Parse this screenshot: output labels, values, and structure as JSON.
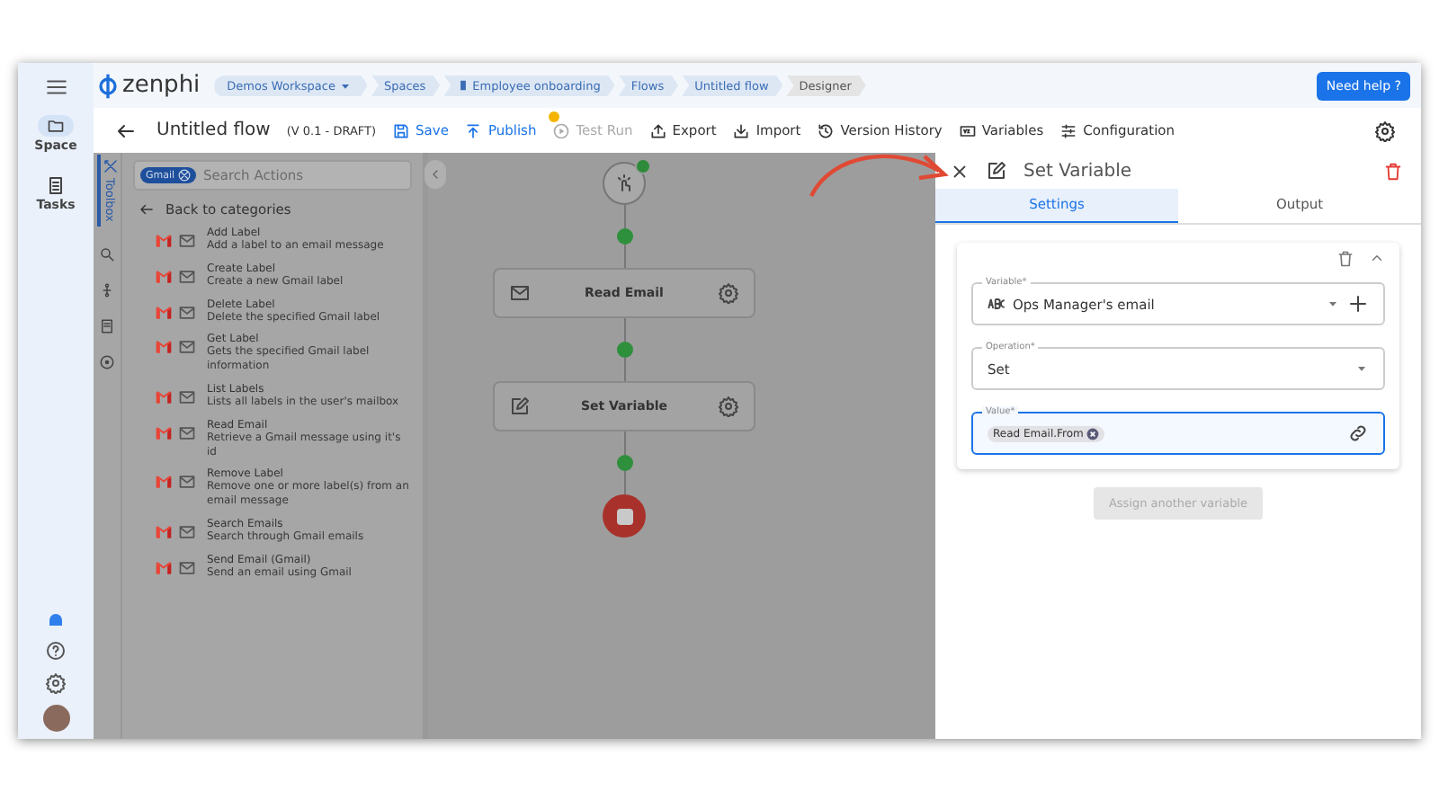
{
  "sidebar": {
    "items": [
      {
        "label": "Space",
        "selected": true
      },
      {
        "label": "Tasks",
        "selected": false
      }
    ]
  },
  "header": {
    "logo": "zenphi",
    "breadcrumbs": [
      "Demos Workspace",
      "Spaces",
      "Employee onboarding",
      "Flows",
      "Untitled flow",
      "Designer"
    ],
    "help_button": "Need help ?"
  },
  "toolbar": {
    "title": "Untitled flow",
    "version": "(V 0.1 - DRAFT)",
    "actions": [
      {
        "label": "Save",
        "kind": "primary"
      },
      {
        "label": "Publish",
        "kind": "primary"
      },
      {
        "label": "Test Run",
        "kind": "disabled"
      },
      {
        "label": "Export",
        "kind": "default"
      },
      {
        "label": "Import",
        "kind": "default"
      },
      {
        "label": "Version History",
        "kind": "default"
      },
      {
        "label": "Variables",
        "kind": "default"
      },
      {
        "label": "Configuration",
        "kind": "default"
      }
    ]
  },
  "toolbox": {
    "tab": "Toolbox",
    "filter_chip": "Gmail",
    "search": {
      "placeholder": "Search Actions"
    },
    "back": "Back to categories",
    "actions": [
      {
        "title": "Add Label",
        "description": "Add a label to an email message"
      },
      {
        "title": "Create Label",
        "description": "Create a new Gmail label"
      },
      {
        "title": "Delete Label",
        "description": "Delete the specified Gmail label"
      },
      {
        "title": "Get Label",
        "description": "Gets the specified Gmail label information"
      },
      {
        "title": "List Labels",
        "description": "Lists all labels in the user's mailbox"
      },
      {
        "title": "Read Email",
        "description": "Retrieve a Gmail message using it's id"
      },
      {
        "title": "Remove Label",
        "description": "Remove one or more label(s) from an email message"
      },
      {
        "title": "Search Emails",
        "description": "Search through Gmail emails"
      },
      {
        "title": "Send Email (Gmail)",
        "description": "Send an email using Gmail"
      }
    ]
  },
  "canvas": {
    "nodes": [
      {
        "label": "Read Email",
        "kind": "email"
      },
      {
        "label": "Set Variable",
        "kind": "edit"
      }
    ]
  },
  "panel": {
    "title": "Set Variable",
    "tabs": [
      {
        "label": "Settings",
        "selected": true
      },
      {
        "label": "Output",
        "selected": false
      }
    ],
    "fields": [
      {
        "label": "Variable*",
        "kind": "variable",
        "value": "Ops Manager's email",
        "focused": false
      },
      {
        "label": "Operation*",
        "kind": "select",
        "value": "Set",
        "focused": false
      },
      {
        "label": "Value*",
        "kind": "chip",
        "value": "Read Email.From",
        "focused": true
      }
    ],
    "assign_button": {
      "label": "Assign another variable",
      "disabled": true
    }
  }
}
